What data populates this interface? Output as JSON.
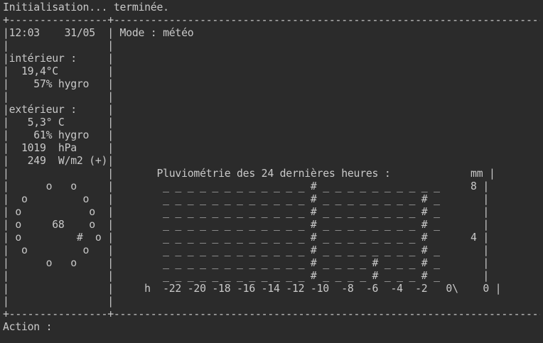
{
  "terminal": {
    "status_line": "Initialisation... terminée.",
    "prompt_line": "Action :",
    "screen_lines": [
      "+----------------+--------------------------------------------------------------------------------------------+",
      "|12:03    31/05  | Mode : météo                                                                               |",
      "|                |                                                                                            |",
      "|intérieur :     |                                                                                            |",
      "|  19,4°C        |                                                                                            |",
      "|    57% hygro   |                                                                                            |",
      "|                |                                                                                            |",
      "|extérieur :     |                                                                                            |",
      "|   5,3° C       |                                                                                            |",
      "|    61% hygro   |                                                                                            |",
      "|  1019  hPa     |                                                                                            |",
      "|   249  W/m2 (+)|                                                                                            |",
      "|                |       Pluviométrie des 24 dernières heures :             mm |",
      "|      o   o     |        _ _ _ _ _ _ _ _ _ _ _ _ # _ _ _ _ _ _ _ _ _ _     8 |",
      "|  o         o   |        _ _ _ _ _ _ _ _ _ _ _ _ # _ _ _ _ _ _ _ _ # _       |",
      "| o           o  |        _ _ _ _ _ _ _ _ _ _ _ _ # _ _ _ _ _ _ _ _ # _       |",
      "| o     68    o  |        _ _ _ _ _ _ _ _ _ _ _ _ # _ _ _ _ _ _ _ _ # _       |",
      "| o         #  o |        _ _ _ _ _ _ _ _ _ _ _ _ # _ _ _ _ _ _ _ _ #       4 |",
      "|  o         o   |        _ _ _ _ _ _ _ _ _ _ _ _ # _ _ _ _ _ _ _ _ # _       |",
      "|      o   o     |        _ _ _ _ _ _ _ _ _ _ _ _ # _ _ _ _ # _ _ _ # _       |",
      "|                |        _ _ _ _ _ _ _ _ _ _ _ _ # _ _ _ _ # _ _ _ # _       |",
      "|                |     h  -22 -20 -18 -16 -14 -12 -10  -8  -6  -4  -2   0\\    0 |",
      "|                |                                                                                            |",
      "+----------------+--------------------------------------------------------------------------------------------+"
    ]
  }
}
